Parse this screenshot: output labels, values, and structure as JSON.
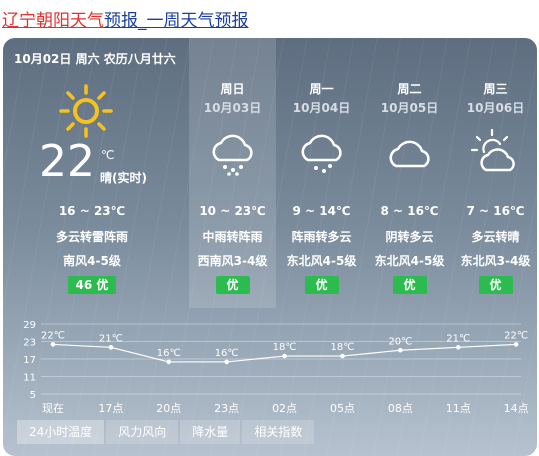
{
  "header": {
    "location": "辽宁朝阳天气",
    "rest": "预报_一周天气预报"
  },
  "today": {
    "date_line": "10月02日 周六 农历八月廿六",
    "temp_now": "22",
    "unit": "℃",
    "cond_now": "晴(实时)",
    "range": "16 ~ 23℃",
    "cond": "多云转雷阵雨",
    "wind": "南风4-5级",
    "aqi": "46 优",
    "icon": "sun-icon"
  },
  "days": [
    {
      "week": "周日",
      "date": "10月03日",
      "range": "10 ~ 23℃",
      "cond": "中雨转阵雨",
      "wind": "西南风3-4级",
      "aqi": "优",
      "icon": "cloud-rain-icon"
    },
    {
      "week": "周一",
      "date": "10月04日",
      "range": "9 ~ 14℃",
      "cond": "阵雨转多云",
      "wind": "东北风4-5级",
      "aqi": "优",
      "icon": "cloud-rain-icon"
    },
    {
      "week": "周二",
      "date": "10月05日",
      "range": "8 ~ 16℃",
      "cond": "阴转多云",
      "wind": "东北风4-5级",
      "aqi": "优",
      "icon": "cloud-icon"
    },
    {
      "week": "周三",
      "date": "10月06日",
      "range": "7 ~ 16℃",
      "cond": "多云转晴",
      "wind": "东北风3-4级",
      "aqi": "优",
      "icon": "partly-cloudy-icon"
    }
  ],
  "tabs": [
    "24小时温度",
    "风力风向",
    "降水量",
    "相关指数"
  ],
  "colors": {
    "aqi_good": "#2cbb4f",
    "title_red": "#e0312f",
    "title_blue": "#1a3fa0"
  },
  "chart_data": {
    "type": "line",
    "title": "",
    "xlabel": "",
    "ylabel": "",
    "categories": [
      "现在",
      "17点",
      "20点",
      "23点",
      "02点",
      "05点",
      "08点",
      "11点",
      "14点"
    ],
    "values": [
      22,
      21,
      16,
      16,
      18,
      18,
      20,
      21,
      22
    ],
    "value_labels": [
      "22℃",
      "21℃",
      "16℃",
      "16℃",
      "18℃",
      "18℃",
      "20℃",
      "21℃",
      "22℃"
    ],
    "y_ticks": [
      29,
      23,
      17,
      11,
      5
    ],
    "ylim": [
      5,
      29
    ],
    "grid": true
  }
}
